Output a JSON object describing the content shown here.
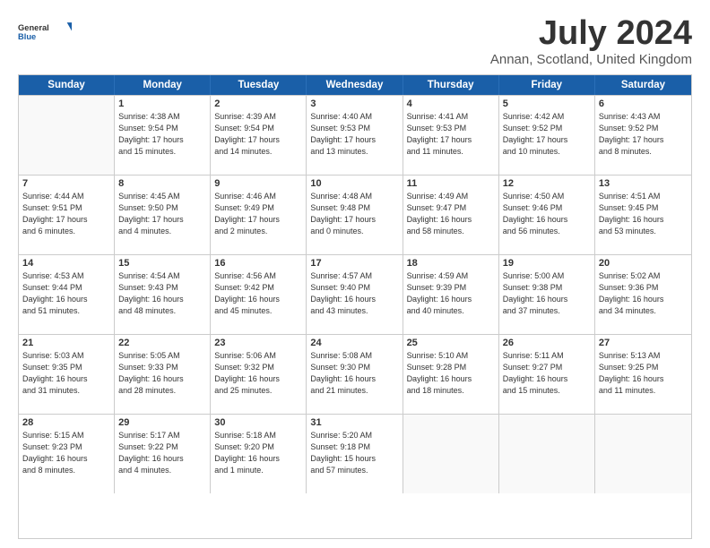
{
  "header": {
    "logo_line1": "General",
    "logo_line2": "Blue",
    "month": "July 2024",
    "location": "Annan, Scotland, United Kingdom"
  },
  "days_of_week": [
    "Sunday",
    "Monday",
    "Tuesday",
    "Wednesday",
    "Thursday",
    "Friday",
    "Saturday"
  ],
  "weeks": [
    [
      {
        "day": "",
        "info": ""
      },
      {
        "day": "1",
        "info": "Sunrise: 4:38 AM\nSunset: 9:54 PM\nDaylight: 17 hours\nand 15 minutes."
      },
      {
        "day": "2",
        "info": "Sunrise: 4:39 AM\nSunset: 9:54 PM\nDaylight: 17 hours\nand 14 minutes."
      },
      {
        "day": "3",
        "info": "Sunrise: 4:40 AM\nSunset: 9:53 PM\nDaylight: 17 hours\nand 13 minutes."
      },
      {
        "day": "4",
        "info": "Sunrise: 4:41 AM\nSunset: 9:53 PM\nDaylight: 17 hours\nand 11 minutes."
      },
      {
        "day": "5",
        "info": "Sunrise: 4:42 AM\nSunset: 9:52 PM\nDaylight: 17 hours\nand 10 minutes."
      },
      {
        "day": "6",
        "info": "Sunrise: 4:43 AM\nSunset: 9:52 PM\nDaylight: 17 hours\nand 8 minutes."
      }
    ],
    [
      {
        "day": "7",
        "info": "Sunrise: 4:44 AM\nSunset: 9:51 PM\nDaylight: 17 hours\nand 6 minutes."
      },
      {
        "day": "8",
        "info": "Sunrise: 4:45 AM\nSunset: 9:50 PM\nDaylight: 17 hours\nand 4 minutes."
      },
      {
        "day": "9",
        "info": "Sunrise: 4:46 AM\nSunset: 9:49 PM\nDaylight: 17 hours\nand 2 minutes."
      },
      {
        "day": "10",
        "info": "Sunrise: 4:48 AM\nSunset: 9:48 PM\nDaylight: 17 hours\nand 0 minutes."
      },
      {
        "day": "11",
        "info": "Sunrise: 4:49 AM\nSunset: 9:47 PM\nDaylight: 16 hours\nand 58 minutes."
      },
      {
        "day": "12",
        "info": "Sunrise: 4:50 AM\nSunset: 9:46 PM\nDaylight: 16 hours\nand 56 minutes."
      },
      {
        "day": "13",
        "info": "Sunrise: 4:51 AM\nSunset: 9:45 PM\nDaylight: 16 hours\nand 53 minutes."
      }
    ],
    [
      {
        "day": "14",
        "info": "Sunrise: 4:53 AM\nSunset: 9:44 PM\nDaylight: 16 hours\nand 51 minutes."
      },
      {
        "day": "15",
        "info": "Sunrise: 4:54 AM\nSunset: 9:43 PM\nDaylight: 16 hours\nand 48 minutes."
      },
      {
        "day": "16",
        "info": "Sunrise: 4:56 AM\nSunset: 9:42 PM\nDaylight: 16 hours\nand 45 minutes."
      },
      {
        "day": "17",
        "info": "Sunrise: 4:57 AM\nSunset: 9:40 PM\nDaylight: 16 hours\nand 43 minutes."
      },
      {
        "day": "18",
        "info": "Sunrise: 4:59 AM\nSunset: 9:39 PM\nDaylight: 16 hours\nand 40 minutes."
      },
      {
        "day": "19",
        "info": "Sunrise: 5:00 AM\nSunset: 9:38 PM\nDaylight: 16 hours\nand 37 minutes."
      },
      {
        "day": "20",
        "info": "Sunrise: 5:02 AM\nSunset: 9:36 PM\nDaylight: 16 hours\nand 34 minutes."
      }
    ],
    [
      {
        "day": "21",
        "info": "Sunrise: 5:03 AM\nSunset: 9:35 PM\nDaylight: 16 hours\nand 31 minutes."
      },
      {
        "day": "22",
        "info": "Sunrise: 5:05 AM\nSunset: 9:33 PM\nDaylight: 16 hours\nand 28 minutes."
      },
      {
        "day": "23",
        "info": "Sunrise: 5:06 AM\nSunset: 9:32 PM\nDaylight: 16 hours\nand 25 minutes."
      },
      {
        "day": "24",
        "info": "Sunrise: 5:08 AM\nSunset: 9:30 PM\nDaylight: 16 hours\nand 21 minutes."
      },
      {
        "day": "25",
        "info": "Sunrise: 5:10 AM\nSunset: 9:28 PM\nDaylight: 16 hours\nand 18 minutes."
      },
      {
        "day": "26",
        "info": "Sunrise: 5:11 AM\nSunset: 9:27 PM\nDaylight: 16 hours\nand 15 minutes."
      },
      {
        "day": "27",
        "info": "Sunrise: 5:13 AM\nSunset: 9:25 PM\nDaylight: 16 hours\nand 11 minutes."
      }
    ],
    [
      {
        "day": "28",
        "info": "Sunrise: 5:15 AM\nSunset: 9:23 PM\nDaylight: 16 hours\nand 8 minutes."
      },
      {
        "day": "29",
        "info": "Sunrise: 5:17 AM\nSunset: 9:22 PM\nDaylight: 16 hours\nand 4 minutes."
      },
      {
        "day": "30",
        "info": "Sunrise: 5:18 AM\nSunset: 9:20 PM\nDaylight: 16 hours\nand 1 minute."
      },
      {
        "day": "31",
        "info": "Sunrise: 5:20 AM\nSunset: 9:18 PM\nDaylight: 15 hours\nand 57 minutes."
      },
      {
        "day": "",
        "info": ""
      },
      {
        "day": "",
        "info": ""
      },
      {
        "day": "",
        "info": ""
      }
    ]
  ]
}
